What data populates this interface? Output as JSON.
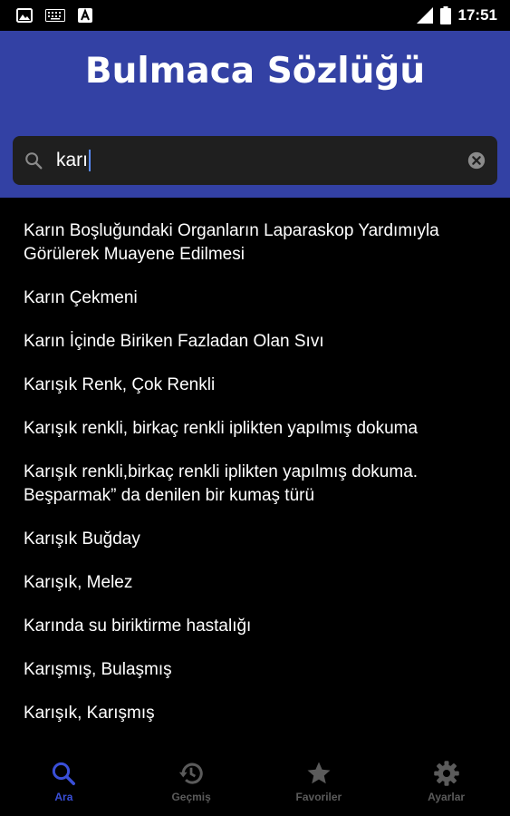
{
  "status": {
    "time": "17:51",
    "icons": [
      "image-icon",
      "keyboard-icon",
      "app-a-icon",
      "signal-icon",
      "battery-icon"
    ]
  },
  "header": {
    "title": "Bulmaca Sözlüğü",
    "background": "#3341a4"
  },
  "search": {
    "value": "karı",
    "icon": "search-icon",
    "clear_icon": "clear-icon"
  },
  "results": [
    "Karın Boşluğundaki Organların Laparaskop Yardımıyla Görülerek Muayene Edilmesi",
    "Karın Çekmeni",
    "Karın İçinde Biriken Fazladan Olan Sıvı",
    "Karışık Renk, Çok Renkli",
    "Karışık renkli, birkaç renkli iplikten yapılmış dokuma",
    "Karışık renkli,birkaç renkli iplikten yapılmış dokuma. Beşparmak” da denilen bir kumaş türü",
    "Karışık Buğday",
    "Karışık, Melez",
    "Karında su biriktirme hastalığı",
    "Karışmış, Bulaşmış",
    "Karışık, Karışmış"
  ],
  "nav": {
    "items": [
      {
        "label": "Ara",
        "icon": "search-icon",
        "active": true
      },
      {
        "label": "Geçmiş",
        "icon": "history-icon",
        "active": false
      },
      {
        "label": "Favoriler",
        "icon": "star-icon",
        "active": false
      },
      {
        "label": "Ayarlar",
        "icon": "gear-icon",
        "active": false
      }
    ],
    "active_color": "#3a4fd8",
    "inactive_color": "#5b5b5b"
  }
}
